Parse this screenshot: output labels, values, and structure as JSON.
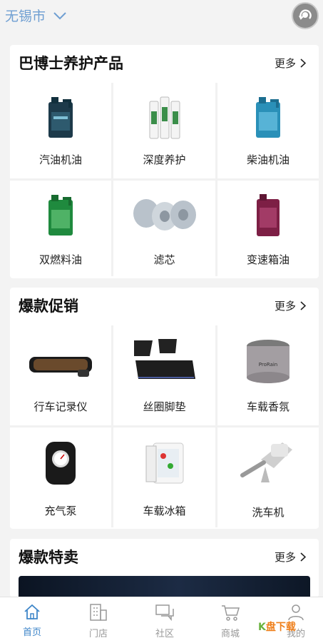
{
  "header": {
    "city": "无锡市"
  },
  "sections": [
    {
      "title": "巴博士养护产品",
      "more": "更多",
      "items": [
        {
          "label": "汽油机油",
          "icon": "oil-bottle-dark"
        },
        {
          "label": "深度养护",
          "icon": "additive-tubes"
        },
        {
          "label": "柴油机油",
          "icon": "oil-bottle-blue"
        },
        {
          "label": "双燃料油",
          "icon": "oil-bottle-green"
        },
        {
          "label": "滤芯",
          "icon": "filter-cylinders"
        },
        {
          "label": "变速箱油",
          "icon": "oil-bottle-purple"
        }
      ]
    },
    {
      "title": "爆款促销",
      "more": "更多",
      "items": [
        {
          "label": "行车记录仪",
          "icon": "dashcam-mirror"
        },
        {
          "label": "丝圈脚垫",
          "icon": "car-floor-mats"
        },
        {
          "label": "车载香氛",
          "icon": "aroma-can"
        },
        {
          "label": "充气泵",
          "icon": "air-pump"
        },
        {
          "label": "车载冰箱",
          "icon": "mini-fridge"
        },
        {
          "label": "洗车机",
          "icon": "washer-gun"
        }
      ]
    },
    {
      "title": "爆款特卖",
      "more": "更多"
    }
  ],
  "nav": [
    {
      "label": "首页",
      "icon": "home-icon",
      "active": true
    },
    {
      "label": "门店",
      "icon": "building-icon"
    },
    {
      "label": "社区",
      "icon": "chat-icon"
    },
    {
      "label": "商城",
      "icon": "cart-icon"
    },
    {
      "label": "我的",
      "icon": "user-icon"
    }
  ],
  "watermark": {
    "k": "K",
    "text": "盘下载"
  },
  "colors": {
    "accent": "#3f86c9",
    "city": "#6f9fd2",
    "background": "#f3f3f3"
  }
}
